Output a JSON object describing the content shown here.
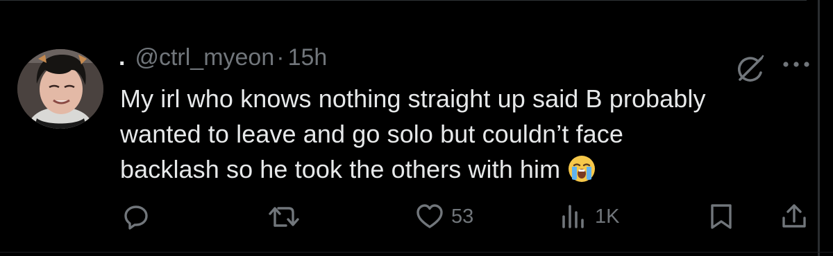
{
  "tweet": {
    "author_prefix": ".",
    "handle": "@ctrl_myeon",
    "separator": "·",
    "time": "15h",
    "lines": [
      "My irl who knows nothing straight up said B probably",
      "wanted to leave and go solo but couldn’t face",
      "backlash so he took the others with him"
    ],
    "emoji": "loudly-crying-face"
  },
  "actions": {
    "reply_icon": "reply-icon",
    "retweet_icon": "retweet-icon",
    "like_icon": "heart-icon",
    "like_count": "53",
    "views_icon": "views-chart-icon",
    "views_count": "1K",
    "bookmark_icon": "bookmark-icon",
    "share_icon": "share-icon"
  },
  "header_icons": {
    "grok": "grok-icon",
    "more": "more-icon"
  },
  "colors": {
    "background": "#000000",
    "text_primary": "#e7e9ea",
    "text_secondary": "#71767b"
  }
}
